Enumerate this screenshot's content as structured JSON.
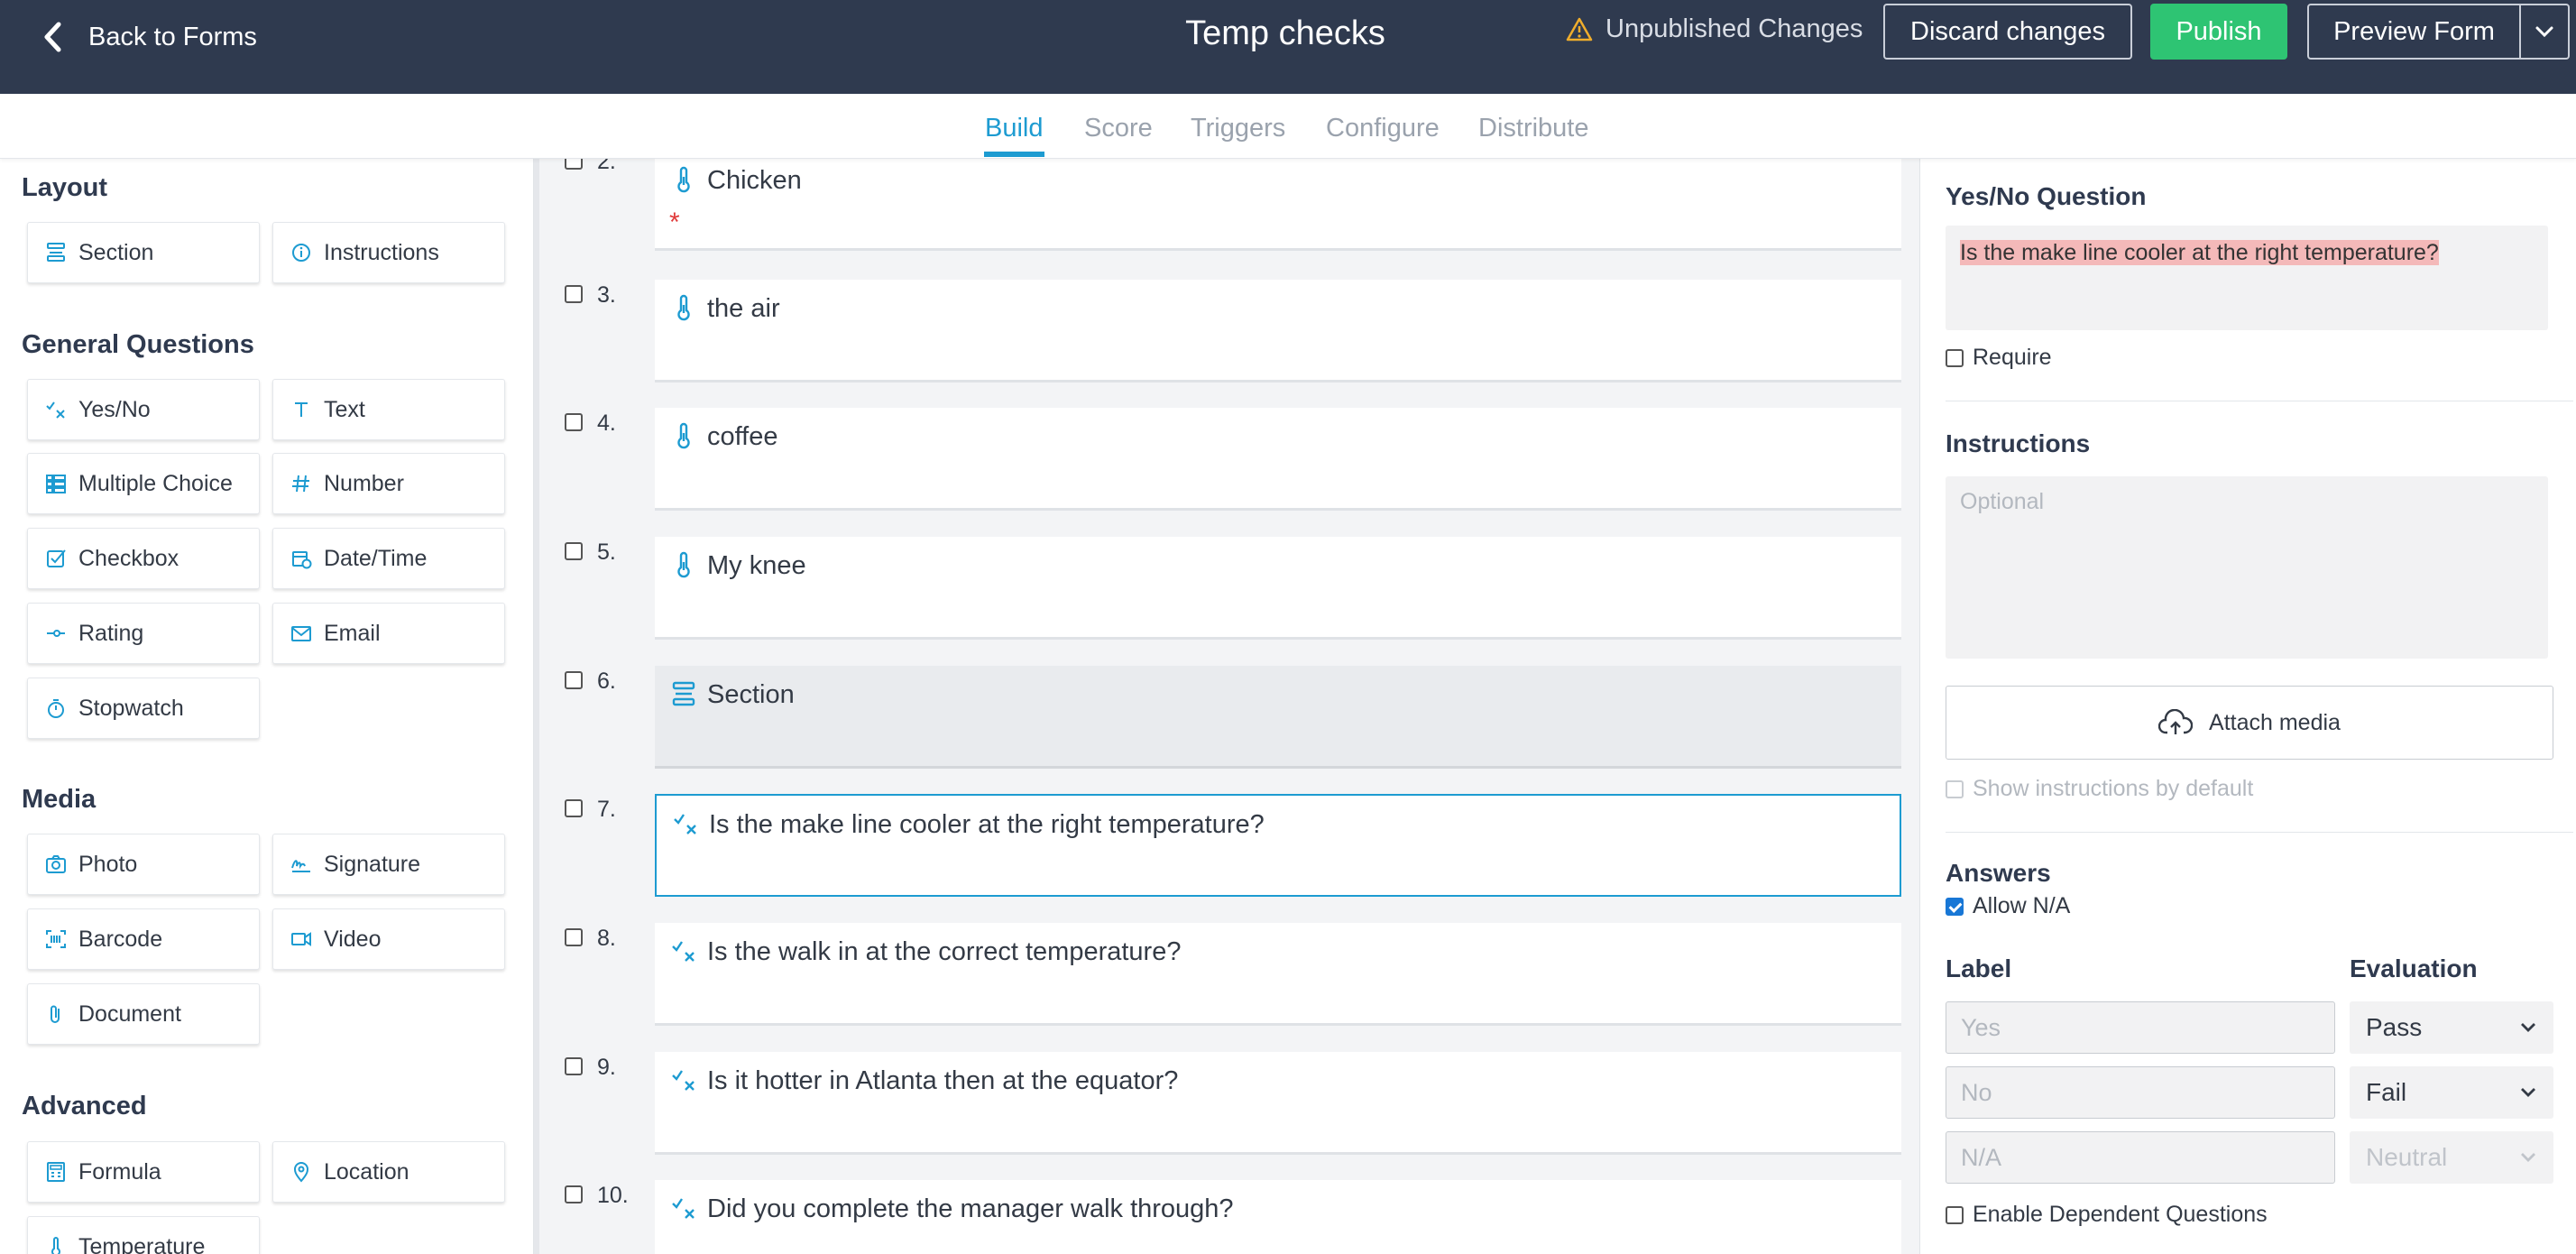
{
  "header": {
    "back_label": "Back to Forms",
    "title": "Temp checks",
    "status": "Unpublished Changes",
    "discard_label": "Discard changes",
    "publish_label": "Publish",
    "preview_label": "Preview Form"
  },
  "tabs": [
    "Build",
    "Score",
    "Triggers",
    "Configure",
    "Distribute"
  ],
  "active_tab": "Build",
  "palette": {
    "layout_title": "Layout",
    "layout": [
      "Section",
      "Instructions"
    ],
    "general_title": "General Questions",
    "general": [
      "Yes/No",
      "Text",
      "Multiple Choice",
      "Number",
      "Checkbox",
      "Date/Time",
      "Rating",
      "Email",
      "Stopwatch"
    ],
    "media_title": "Media",
    "media": [
      "Photo",
      "Signature",
      "Barcode",
      "Video",
      "Document"
    ],
    "advanced_title": "Advanced",
    "advanced": [
      "Formula",
      "Location",
      "Temperature"
    ]
  },
  "questions": [
    {
      "num": "2.",
      "text": "Chicken",
      "icon": "thermometer-icon",
      "required_mark": "*"
    },
    {
      "num": "3.",
      "text": "the air",
      "icon": "thermometer-icon"
    },
    {
      "num": "4.",
      "text": "coffee",
      "icon": "thermometer-icon"
    },
    {
      "num": "5.",
      "text": "My knee",
      "icon": "thermometer-icon"
    },
    {
      "num": "6.",
      "text": "Section",
      "icon": "section-icon"
    },
    {
      "num": "7.",
      "text": "Is the make line cooler at the right temperature?",
      "icon": "yes-no-icon"
    },
    {
      "num": "8.",
      "text": "Is the walk in at the correct temperature?",
      "icon": "yes-no-icon"
    },
    {
      "num": "9.",
      "text": "Is it hotter in Atlanta then at the equator?",
      "icon": "yes-no-icon"
    },
    {
      "num": "10.",
      "text": "Did you complete the manager walk through?",
      "icon": "yes-no-icon"
    }
  ],
  "editor": {
    "type_title": "Yes/No Question",
    "question_text": "Is the make line cooler at the right temperature?",
    "require_label": "Require",
    "instructions_title": "Instructions",
    "instructions_placeholder": "Optional",
    "attach_label": "Attach media",
    "show_instructions_label": "Show instructions by default",
    "answers_title": "Answers",
    "allow_na_label": "Allow N/A",
    "allow_na_checked": true,
    "label_col": "Label",
    "evaluation_col": "Evaluation",
    "answers": [
      {
        "placeholder": "Yes",
        "evaluation": "Pass"
      },
      {
        "placeholder": "No",
        "evaluation": "Fail"
      },
      {
        "placeholder": "N/A",
        "evaluation": "Neutral"
      }
    ],
    "dependent_label": "Enable Dependent Questions"
  },
  "colors": {
    "accent": "#1d9bd1",
    "header_bg": "#2f3a4f",
    "publish": "#2ec473",
    "warning": "#f0ad2c"
  }
}
